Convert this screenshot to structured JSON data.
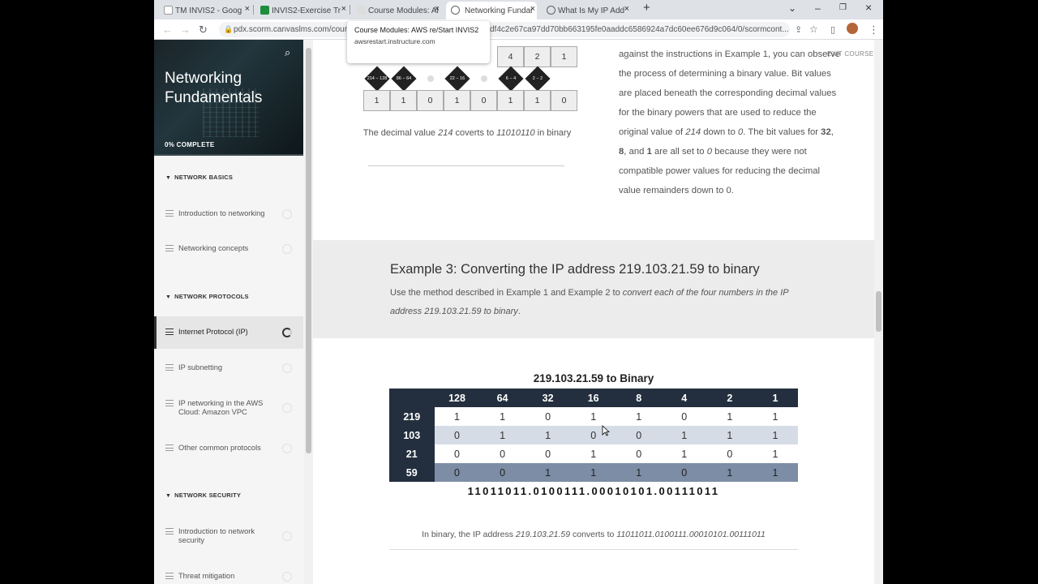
{
  "browser": {
    "tabs": [
      {
        "title": "TM INVIS2 - Goog",
        "favicon_color": "#ffffff"
      },
      {
        "title": "INVIS2-Exercise Tr",
        "favicon_color": "#1e8e3e"
      },
      {
        "title": "Course Modules: Al",
        "favicon_color": "#e0e0e0"
      },
      {
        "title": "Networking Fundar",
        "favicon_color": "#5f6368"
      },
      {
        "title": "What Is My IP Add",
        "favicon_color": "#5f6368"
      }
    ],
    "close_glyph": "×",
    "new_tab_glyph": "+",
    "address_left": "pdx.scorm.canvaslms.com/cour",
    "address_right": "df4c2e67ca97dd70bb663195fe0aaddc6586924a7dc60ee676d9c064/0/scormcont...",
    "tooltip": {
      "title": "Course Modules: AWS re/Start INVIS2",
      "url": "awsrestart.instructure.com"
    }
  },
  "sidebar": {
    "course_title": "Networking Fundamentals",
    "progress_label": "0% COMPLETE",
    "progress_fraction": 0,
    "sections": [
      {
        "title": "NETWORK BASICS",
        "lessons": [
          "Introduction to networking",
          "Networking concepts"
        ]
      },
      {
        "title": "NETWORK PROTOCOLS",
        "lessons": [
          "Internet Protocol (IP)",
          "IP subnetting",
          "IP networking in the AWS Cloud: Amazon VPC",
          "Other common protocols"
        ]
      },
      {
        "title": "NETWORK SECURITY",
        "lessons": [
          "Introduction to network security",
          "Threat mitigation"
        ]
      }
    ],
    "active_lesson": "Internet Protocol (IP)"
  },
  "main": {
    "exit_label": "EXIT COURSE",
    "example2": {
      "top_values": [
        "4",
        "2",
        "1"
      ],
      "bits": [
        "1",
        "1",
        "0",
        "1",
        "0",
        "1",
        "1",
        "0"
      ],
      "steps": [
        "214 − 128",
        "86 − 64",
        "22 − 16",
        "6 − 4",
        "2 − 2"
      ],
      "caption_pre": "The decimal value ",
      "caption_value": "214",
      "caption_mid": " coverts to ",
      "caption_binary": "11010110",
      "caption_post": " in binary",
      "para_1": "against the instructions in Example 1, you can observe the process of determining a binary value. Bit values are placed beneath the corresponding decimal values for the binary powers that are used to reduce the original value of ",
      "para_value": "214",
      "para_2": " down to ",
      "para_zero": "0",
      "para_3": ". The bit values for ",
      "para_b1": "32",
      "para_b2": "8",
      "para_and": ", and ",
      "para_b3": "1",
      "para_4": " are all set to ",
      "para_zero2": "0",
      "para_5": " because they were not compatible power values for reducing the decimal value remainders down to 0."
    },
    "example3": {
      "title": "Example 3: Converting the IP address 219.103.21.59 to binary",
      "desc_pre": "Use the method described in Example 1 and Example 2 to ",
      "desc_italic": "convert each of the four numbers in the IP address 219.103.21.59 to binary",
      "desc_post": "."
    },
    "table": {
      "title": "219.103.21.59 to Binary",
      "columns": [
        "128",
        "64",
        "32",
        "16",
        "8",
        "4",
        "2",
        "1"
      ],
      "rows": [
        {
          "label": "219",
          "bits": [
            "1",
            "1",
            "0",
            "1",
            "1",
            "0",
            "1",
            "1"
          ]
        },
        {
          "label": "103",
          "bits": [
            "0",
            "1",
            "1",
            "0",
            "0",
            "1",
            "1",
            "1"
          ]
        },
        {
          "label": "21",
          "bits": [
            "0",
            "0",
            "0",
            "1",
            "0",
            "1",
            "0",
            "1"
          ]
        },
        {
          "label": "59",
          "bits": [
            "0",
            "0",
            "1",
            "1",
            "1",
            "0",
            "1",
            "1"
          ]
        }
      ],
      "result": "11011011.0100111.00010101.00111011",
      "caption_pre": "In binary, the IP address ",
      "caption_ip": "219.103.21.59",
      "caption_mid": " converts to ",
      "caption_binary": "11011011.0100111.00010101.00111011"
    }
  }
}
